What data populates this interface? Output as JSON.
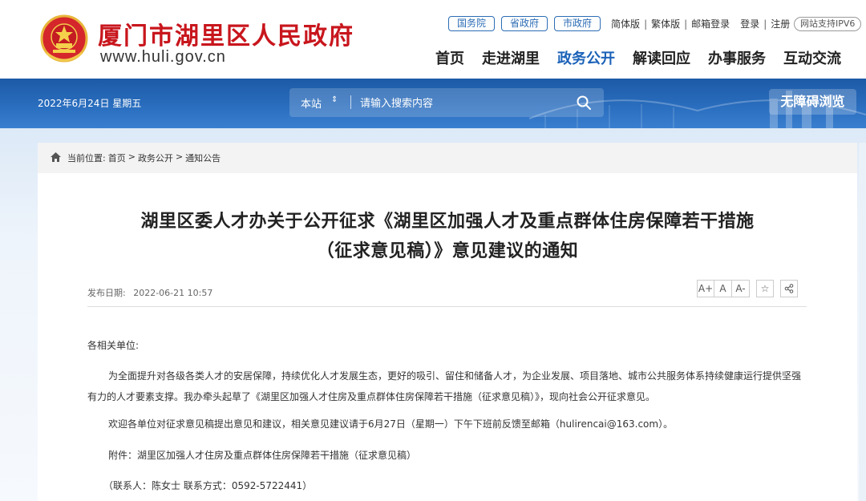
{
  "header": {
    "site_name": "厦门市湖里区人民政府",
    "site_url": "www.huli.gov.cn",
    "gov_links": [
      "国务院",
      "省政府",
      "市政府"
    ],
    "links": [
      "简体版",
      "繁体版",
      "邮箱登录",
      "登录",
      "注册"
    ],
    "ipv6": "网站支持IPV6",
    "nav": [
      "首页",
      "走进湖里",
      "政务公开",
      "解读回应",
      "办事服务",
      "互动交流"
    ],
    "active_nav": "政务公开"
  },
  "banner": {
    "date": "2022年6月24日  星期五",
    "search_scope": "本站",
    "search_arrow": "⇕",
    "search_placeholder": "请输入搜索内容",
    "accessibility": "无障碍浏览"
  },
  "breadcrumb": {
    "label": "当前位置:",
    "items": [
      "首页",
      ">",
      "政务公开",
      ">",
      "通知公告"
    ]
  },
  "article": {
    "title_line1": "湖里区委人才办关于公开征求《湖里区加强人才及重点群体住房保障若干措施",
    "title_line2": "（征求意见稿）》意见建议的通知",
    "pub_label": "发布日期:",
    "pub_date": "2022-06-21 10:57",
    "tools": [
      "A+",
      "A",
      "A-",
      "☆",
      "share"
    ],
    "salutation": "各相关单位:",
    "para1": "为全面提升对各级各类人才的安居保障，持续优化人才发展生态，更好的吸引、留住和储备人才，为企业发展、项目落地、城市公共服务体系持续健康运行提供坚强有力的人才要素支撑。我办牵头起草了《湖里区加强人才住房及重点群体住房保障若干措施（征求意见稿）》，现向社会公开征求意见。",
    "para2": "欢迎各单位对征求意见稿提出意见和建议，相关意见建议请于6月27日（星期一）下午下班前反馈至邮箱（hulirencai@163.com）。",
    "para3": "附件：湖里区加强人才住房及重点群体住房保障若干措施（征求意见稿）",
    "para4": "（联系人：陈女士    联系方式：0592-5722441）"
  },
  "colors": {
    "brand_red": "#c8161d",
    "nav_active": "#1b62b8",
    "banner_blue": "#2b6fc0"
  }
}
